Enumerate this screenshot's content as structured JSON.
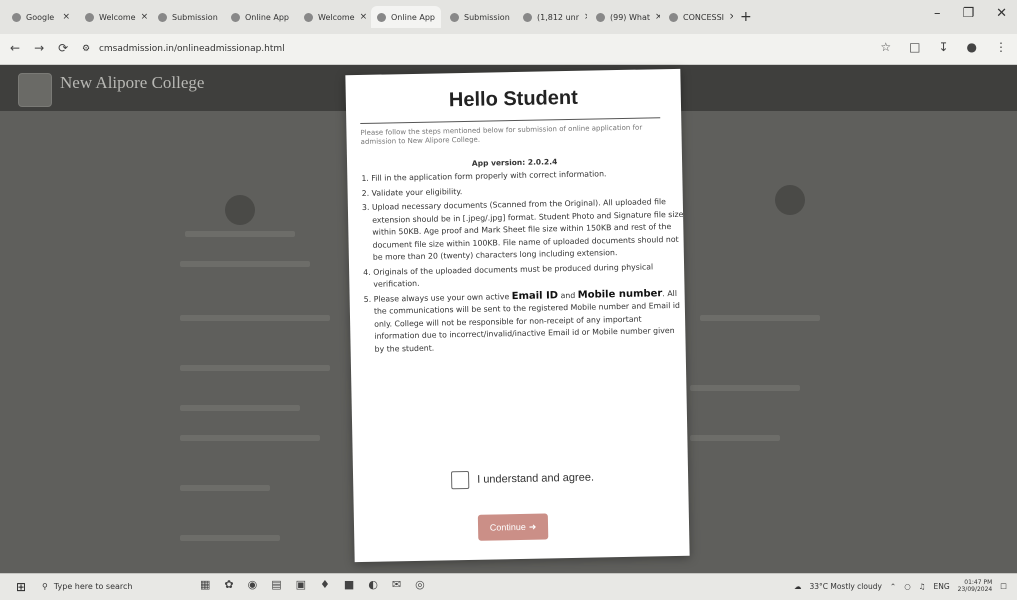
{
  "browser": {
    "tabs": [
      {
        "label": "Google",
        "active": false
      },
      {
        "label": "Welcome",
        "active": false
      },
      {
        "label": "Submission",
        "active": false
      },
      {
        "label": "Online App",
        "active": false
      },
      {
        "label": "Welcome",
        "active": false
      },
      {
        "label": "Online App",
        "active": true
      },
      {
        "label": "Submission",
        "active": false
      },
      {
        "label": "(1,812 unr",
        "active": false
      },
      {
        "label": "(99) What",
        "active": false
      },
      {
        "label": "CONCESSI",
        "active": false
      }
    ],
    "new_tab_label": "+",
    "url": "cmsadmission.in/onlineadmissionap.html"
  },
  "page": {
    "college_name": "New Alipore College"
  },
  "modal": {
    "title": "Hello Student",
    "intro": "Please follow the steps mentioned below for submission of online application for admission to New Alipore College.",
    "app_version": "App version: 2.0.2.4",
    "steps": [
      "Fill in the application form properly with correct information.",
      "Validate your eligibility.",
      "Upload necessary documents (Scanned from the Original). All uploaded file extension should be in [.jpeg/.jpg] format. Student Photo and Signature file size within 50KB. Age proof and Mark Sheet file size within 150KB and rest of the document file size within 100KB. File name of uploaded documents should not be more than 20 (twenty) characters long including extension.",
      "Originals of the uploaded documents must be produced during physical verification.",
      "Please always use your own active"
    ],
    "step5": {
      "email": "Email ID",
      "and": "and",
      "mobile": "Mobile number",
      "rest": ". All the communications will be sent to the registered Mobile number and Email id only. College will not be responsible for non-receipt of any important information due to incorrect/invalid/inactive Email id or Mobile number given by the student."
    },
    "agree_label": "I understand and agree.",
    "continue_label": "Continue",
    "continue_color": "#cb8f87"
  },
  "taskbar": {
    "search_placeholder": "Type here to search",
    "weather": "33°C Mostly cloudy",
    "language": "ENG",
    "time": "01:47 PM",
    "date": "23/09/2024"
  }
}
